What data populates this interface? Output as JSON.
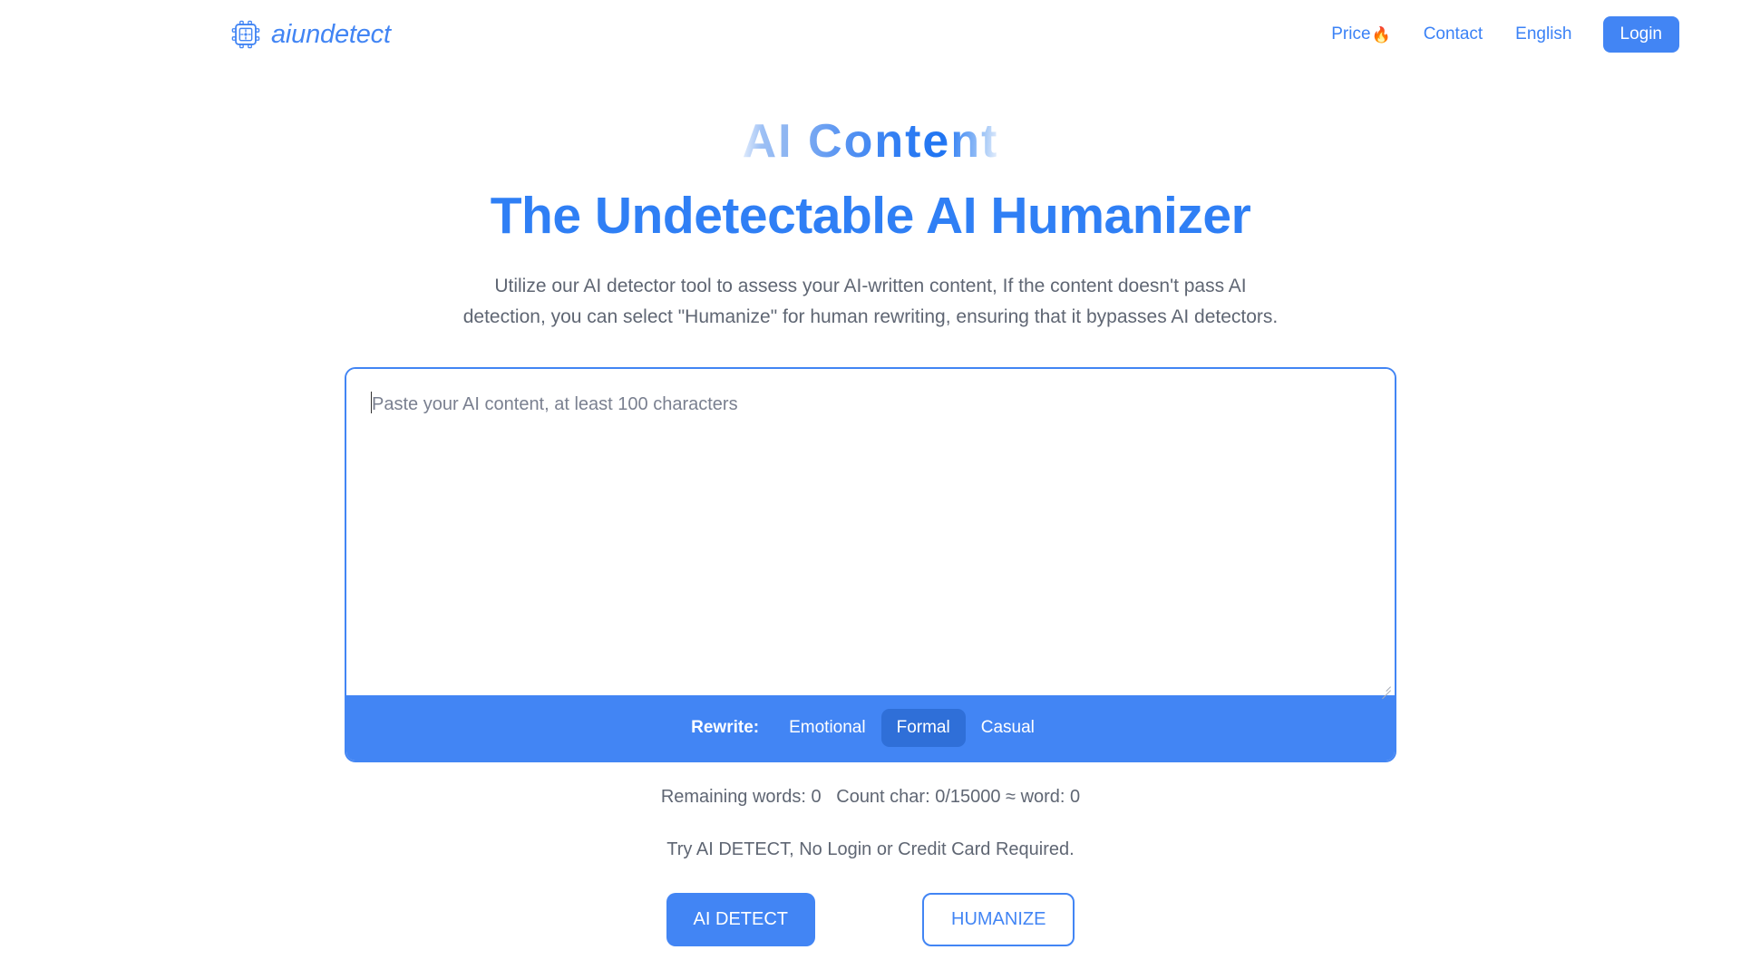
{
  "brand": {
    "name": "aiundetect",
    "icon": "cpu-chip-crosshair-icon"
  },
  "nav": {
    "items": [
      {
        "label": "Price",
        "icon": "fire-emoji",
        "emoji": "🔥"
      },
      {
        "label": "Contact",
        "icon": "",
        "emoji": ""
      },
      {
        "label": "English",
        "icon": "",
        "emoji": ""
      }
    ],
    "login_label": "Login"
  },
  "hero": {
    "eyebrow": "AI  Content",
    "headline": "The Undetectable AI Humanizer",
    "lede": "Utilize our AI detector tool to assess your AI-written content, If the content doesn't pass AI detection, you can select \"Humanize\" for human rewriting, ensuring that it bypasses AI detectors."
  },
  "editor": {
    "placeholder": "Paste your AI content, at least 100 characters",
    "value": "",
    "resize_handle": "resize-grip-icon"
  },
  "rewrite": {
    "label": "Rewrite:",
    "options": [
      {
        "label": "Emotional",
        "selected": false
      },
      {
        "label": "Formal",
        "selected": true
      },
      {
        "label": "Casual",
        "selected": false
      }
    ],
    "selected": "Formal"
  },
  "counters": {
    "text": "Remaining words: 0   Count char: 0/15000 ≈ word: 0",
    "remaining_words": "0",
    "count_char": "0/15000",
    "approx_word": "0",
    "max_chars": "15000"
  },
  "footer": {
    "try_note": "Try AI DETECT, No Login or Credit Card Required.",
    "detect_label": "AI DETECT",
    "humanize_label": "HUMANIZE"
  },
  "colors": {
    "brand_blue": "#4285f4",
    "link_blue": "#3b82f6",
    "headline_blue": "#2f7ff5",
    "tone_active": "#2f6fd8",
    "body_text": "#5f6673",
    "page_bg": "#ffffff"
  }
}
